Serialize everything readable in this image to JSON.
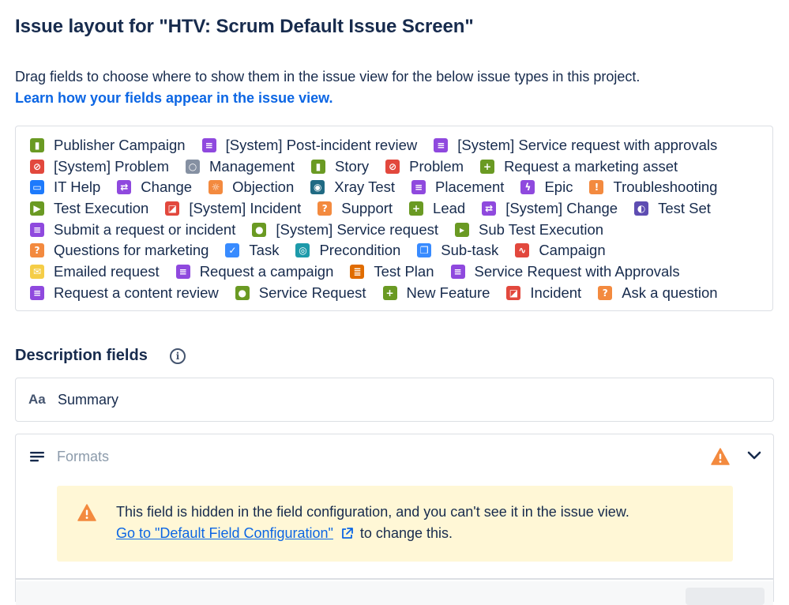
{
  "page": {
    "title": "Issue layout for \"HTV: Scrum Default Issue Screen\"",
    "description": "Drag fields to choose where to show them in the issue view for the below issue types in this project.",
    "learn_link": "Learn how your fields appear in the issue view."
  },
  "issue_types": [
    [
      {
        "label": "Publisher Campaign",
        "icon": "bookmark-icon",
        "color": "#6a9a23",
        "glyph": "▮"
      },
      {
        "label": "[System] Post-incident review",
        "icon": "document-icon",
        "color": "#8f49de",
        "glyph": "≡"
      },
      {
        "label": "[System] Service request with approvals",
        "icon": "document-icon",
        "color": "#8f49de",
        "glyph": "≡"
      }
    ],
    [
      {
        "label": "[System] Problem",
        "icon": "blocked-icon",
        "color": "#e2483d",
        "glyph": "⊘"
      },
      {
        "label": "Management",
        "icon": "circle-icon",
        "color": "#8590a2",
        "glyph": "○"
      },
      {
        "label": "Story",
        "icon": "bookmark-icon",
        "color": "#6a9a23",
        "glyph": "▮"
      },
      {
        "label": "Problem",
        "icon": "blocked-icon",
        "color": "#e2483d",
        "glyph": "⊘"
      },
      {
        "label": "Request a marketing asset",
        "icon": "plus-icon",
        "color": "#6a9a23",
        "glyph": "+"
      }
    ],
    [
      {
        "label": "IT Help",
        "icon": "monitor-icon",
        "color": "#1d7afc",
        "glyph": "▭"
      },
      {
        "label": "Change",
        "icon": "arrows-icon",
        "color": "#8f49de",
        "glyph": "⇄"
      },
      {
        "label": "Objection",
        "icon": "lightbulb-icon",
        "color": "#f38a3f",
        "glyph": "☼"
      },
      {
        "label": "Xray Test",
        "icon": "target-icon",
        "color": "#206a83",
        "glyph": "◉"
      },
      {
        "label": "Placement",
        "icon": "document-icon",
        "color": "#8f49de",
        "glyph": "≡"
      },
      {
        "label": "Epic",
        "icon": "lightning-icon",
        "color": "#8f49de",
        "glyph": "ϟ"
      },
      {
        "label": "Troubleshooting",
        "icon": "exclamation-icon",
        "color": "#f38a3f",
        "glyph": "!"
      }
    ],
    [
      {
        "label": "Test Execution",
        "icon": "play-icon",
        "color": "#6a9a23",
        "glyph": "▶"
      },
      {
        "label": "[System] Incident",
        "icon": "incident-icon",
        "color": "#e2483d",
        "glyph": "◪"
      },
      {
        "label": "Support",
        "icon": "question-icon",
        "color": "#f38a3f",
        "glyph": "?"
      },
      {
        "label": "Lead",
        "icon": "plus-icon",
        "color": "#6a9a23",
        "glyph": "+"
      },
      {
        "label": "[System] Change",
        "icon": "arrows-icon",
        "color": "#8f49de",
        "glyph": "⇄"
      },
      {
        "label": "Test Set",
        "icon": "test-set-icon",
        "color": "#5e4db2",
        "glyph": "◐"
      }
    ],
    [
      {
        "label": "Submit a request or incident",
        "icon": "document-icon",
        "color": "#8f49de",
        "glyph": "≡"
      },
      {
        "label": "[System] Service request",
        "icon": "chat-icon",
        "color": "#6a9a23",
        "glyph": "●"
      },
      {
        "label": "Sub Test Execution",
        "icon": "fast-forward-icon",
        "color": "#6a9a23",
        "glyph": "▸"
      }
    ],
    [
      {
        "label": "Questions for marketing",
        "icon": "question-icon",
        "color": "#f38a3f",
        "glyph": "?"
      },
      {
        "label": "Task",
        "icon": "checkmark-icon",
        "color": "#388bff",
        "glyph": "✓"
      },
      {
        "label": "Precondition",
        "icon": "precondition-icon",
        "color": "#1d9aaa",
        "glyph": "◎"
      },
      {
        "label": "Sub-task",
        "icon": "subtask-icon",
        "color": "#388bff",
        "glyph": "❐"
      },
      {
        "label": "Campaign",
        "icon": "pulse-icon",
        "color": "#e2483d",
        "glyph": "∿"
      }
    ],
    [
      {
        "label": "Emailed request",
        "icon": "envelope-icon",
        "color": "#f5cd47",
        "glyph": "✉"
      },
      {
        "label": "Request a campaign",
        "icon": "document-icon",
        "color": "#8f49de",
        "glyph": "≡"
      },
      {
        "label": "Test Plan",
        "icon": "test-plan-icon",
        "color": "#e06c00",
        "glyph": "≣"
      },
      {
        "label": "Service Request with Approvals",
        "icon": "document-icon",
        "color": "#8f49de",
        "glyph": "≡"
      }
    ],
    [
      {
        "label": "Request a content review",
        "icon": "document-icon",
        "color": "#8f49de",
        "glyph": "≡"
      },
      {
        "label": "Service Request",
        "icon": "chat-icon",
        "color": "#6a9a23",
        "glyph": "●"
      },
      {
        "label": "New Feature",
        "icon": "plus-icon",
        "color": "#6a9a23",
        "glyph": "+"
      },
      {
        "label": "Incident",
        "icon": "incident-icon",
        "color": "#e2483d",
        "glyph": "◪"
      },
      {
        "label": "Ask a question",
        "icon": "question-icon",
        "color": "#f38a3f",
        "glyph": "?"
      }
    ]
  ],
  "description_fields": {
    "title": "Description fields",
    "info_icon": "info-icon",
    "summary": {
      "icon": "Aa",
      "label": "Summary"
    },
    "formats": {
      "label": "Formats",
      "warning_color": "#e56910",
      "warning_text": "This field is hidden in the field configuration, and you can't see it in the issue view.",
      "link_text": "Go to \"Default Field Configuration\"",
      "after_link": "to change this."
    }
  },
  "colors": {
    "text": "#172b4d",
    "link": "#0c66e4",
    "border": "#dcdfe4",
    "warning_bg": "#fff7d6"
  }
}
